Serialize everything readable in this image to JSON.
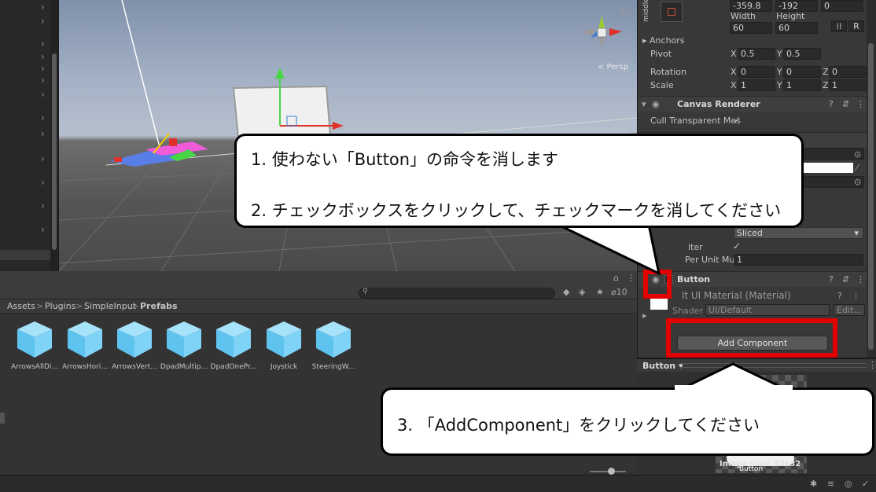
{
  "hierarchy": {
    "expand_rows": 8
  },
  "scene": {
    "persp_label": "< Persp"
  },
  "inspector": {
    "anchor_preset_label": "middle",
    "pos_values": [
      "-359.8",
      "-192",
      "0"
    ],
    "width_label": "Width",
    "height_label": "Height",
    "width_value": "60",
    "height_value": "60",
    "r_button": "R",
    "anchors_label": "Anchors",
    "pivot_label": "Pivot",
    "pivot_x": "0.5",
    "pivot_y": "0.5",
    "rotation_label": "Rotation",
    "rotation": [
      "0",
      "0",
      "0"
    ],
    "scale_label": "Scale",
    "scale": [
      "1",
      "1",
      "1"
    ],
    "axis_x": "X",
    "axis_y": "Y",
    "axis_z": "Z",
    "canvas_renderer_title": "Canvas Renderer",
    "cull_label": "Cull Transparent Mes",
    "image_type_value": "Sliced",
    "fill_center_label": "iter",
    "ppu_label": "Per Unit Mul",
    "ppu_value": "1",
    "button_title": "Button",
    "material_title": "lt UI Material (Material)",
    "shader_label": "Shader",
    "shader_value": "UI/Default",
    "edit_button": "Edit...",
    "add_component": "Add Component"
  },
  "project": {
    "hidden_count": "10",
    "breadcrumb": [
      "Assets",
      "Plugins",
      "SimpleInput",
      "Prefabs"
    ],
    "assets": [
      "ArrowsAllDi...",
      "ArrowsHori...",
      "ArrowsVert...",
      "DpadMultip...",
      "DpadOnePr...",
      "Joystick",
      "SteeringW..."
    ]
  },
  "preview": {
    "title": "Button",
    "image_label": "Button",
    "image_size": "Image Size: 32x32"
  },
  "callouts": {
    "step1": "1. 使わない「Button」の命令を消します",
    "step2": "2. チェックボックスをクリックして、チェックマークを消してください",
    "step3": "3. 「AddComponent」をクリックしてください"
  },
  "colors": {
    "highlight": "#e20000",
    "asset_icon": "#7fd3f7"
  }
}
